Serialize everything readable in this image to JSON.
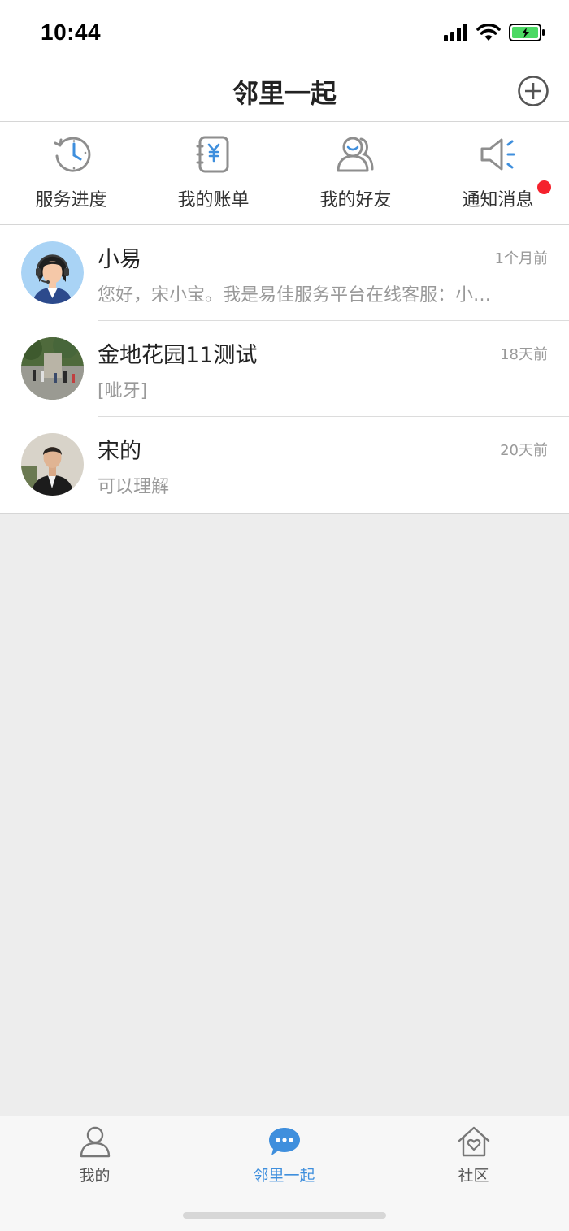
{
  "status_bar": {
    "time": "10:44"
  },
  "nav": {
    "title": "邻里一起",
    "add_icon": "plus-circle-icon"
  },
  "quick_actions": [
    {
      "label": "服务进度",
      "icon": "clock-history-icon"
    },
    {
      "label": "我的账单",
      "icon": "bill-icon"
    },
    {
      "label": "我的好友",
      "icon": "friends-icon"
    },
    {
      "label": "通知消息",
      "icon": "speaker-icon",
      "unread_dot": true
    }
  ],
  "conversations": [
    {
      "name": "小易",
      "time": "1个月前",
      "preview": "您好，宋小宝。我是易佳服务平台在线客服：小…",
      "avatar": "service-agent-avatar"
    },
    {
      "name": "金地花园11测试",
      "time": "18天前",
      "preview": "[呲牙]",
      "avatar": "street-photo-avatar"
    },
    {
      "name": "宋的",
      "time": "20天前",
      "preview": "可以理解",
      "avatar": "person-photo-avatar"
    }
  ],
  "tab_bar": {
    "tabs": [
      {
        "label": "我的",
        "icon": "person-icon",
        "active": false
      },
      {
        "label": "邻里一起",
        "icon": "chat-bubble-icon",
        "active": true
      },
      {
        "label": "社区",
        "icon": "house-heart-icon",
        "active": false
      }
    ]
  },
  "colors": {
    "accent": "#3f8fdd",
    "icon_gray": "#8e8e8e",
    "badge_red": "#f5222d",
    "battery_green": "#4cd964"
  }
}
